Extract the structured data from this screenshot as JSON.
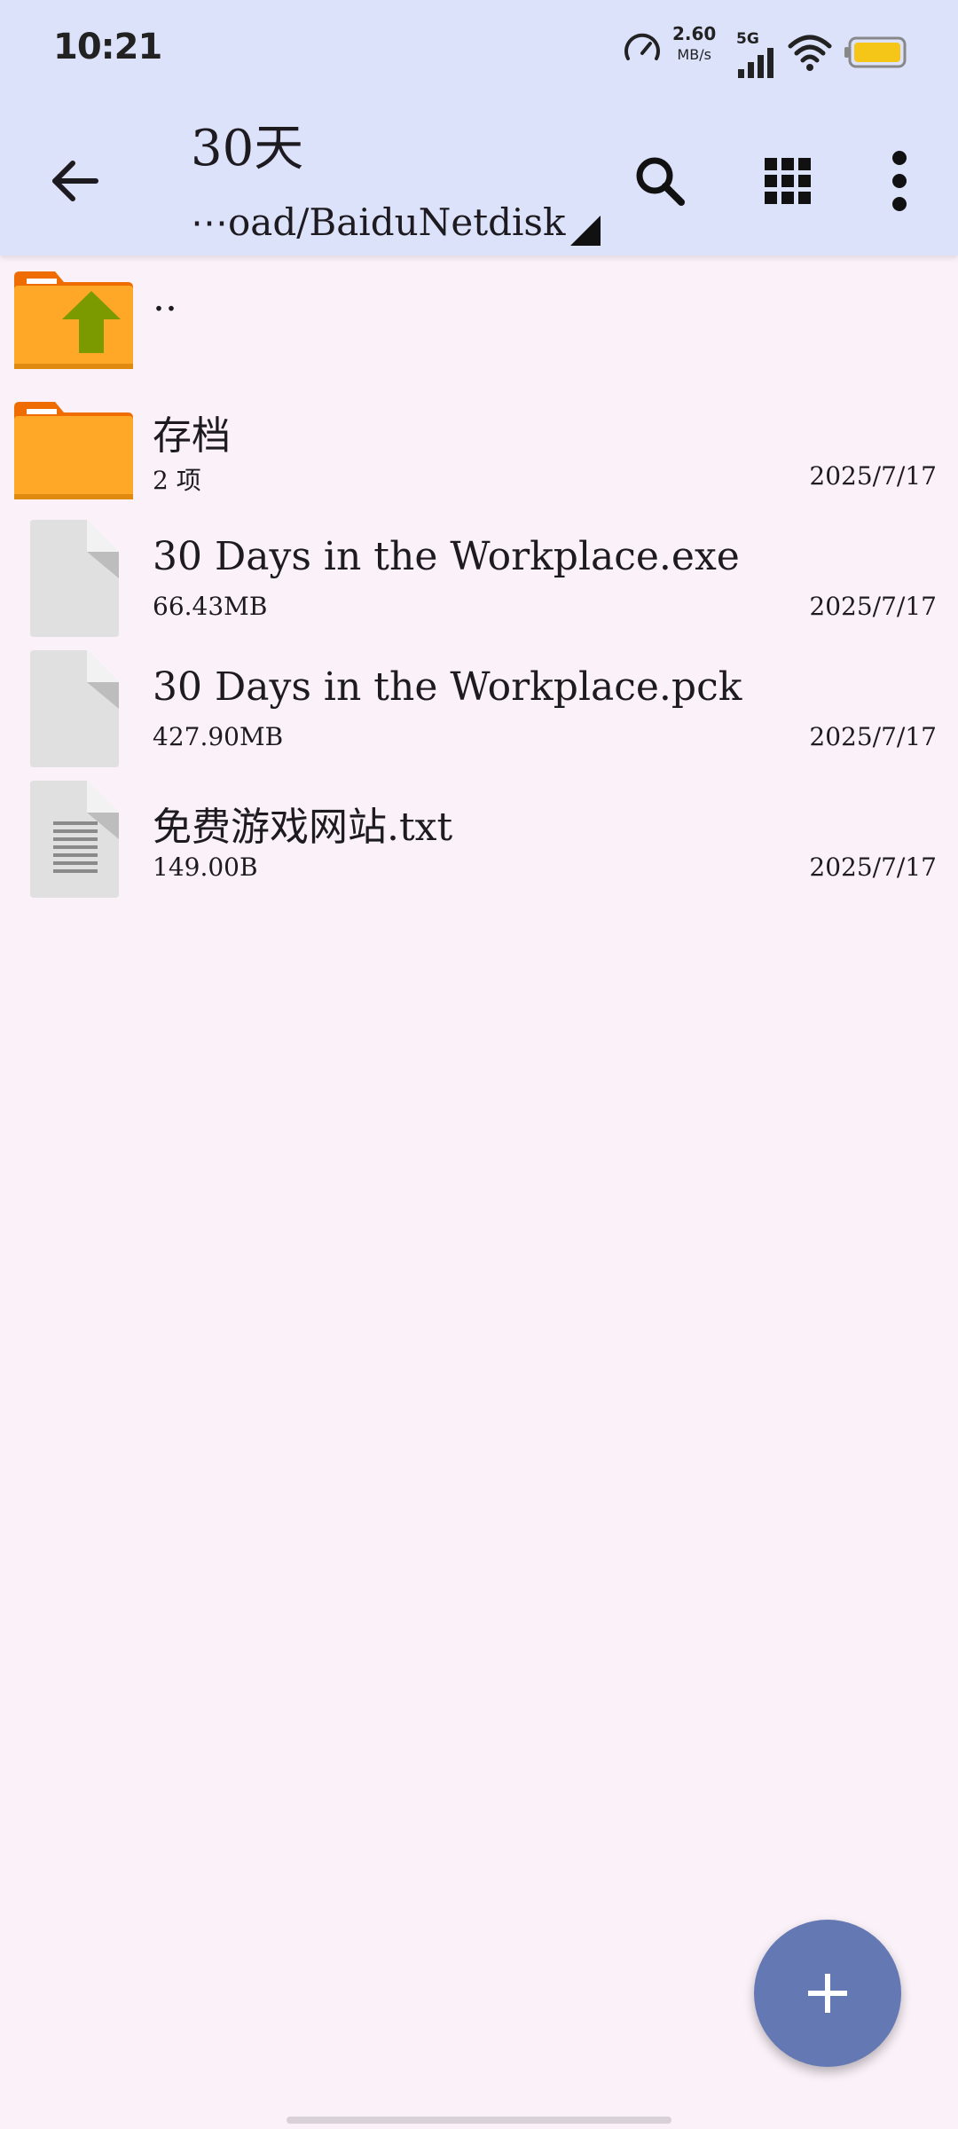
{
  "status_bar": {
    "time": "10:21",
    "net_speed_value": "2.60",
    "net_speed_unit": "MB/s",
    "network_type": "5G",
    "battery_color": "#f5c518"
  },
  "app_bar": {
    "title": "30天",
    "path": "⋯oad/BaiduNetdisk",
    "background": "#dde2fb"
  },
  "files": [
    {
      "name": "..",
      "kind": "parent-folder",
      "meta": "",
      "date": ""
    },
    {
      "name": "存档",
      "kind": "folder",
      "meta": "2 项",
      "date": "2025/7/17"
    },
    {
      "name": "30 Days in the Workplace.exe",
      "kind": "file",
      "meta": "66.43MB",
      "date": "2025/7/17"
    },
    {
      "name": "30 Days in the Workplace.pck",
      "kind": "file",
      "meta": "427.90MB",
      "date": "2025/7/17"
    },
    {
      "name": "免费游戏网站.txt",
      "kind": "text-file",
      "meta": "149.00B",
      "date": "2025/7/17"
    }
  ],
  "fab": {
    "color": "#6478b4",
    "icon": "plus-icon"
  },
  "colors": {
    "page_background": "#fbf2f9",
    "folder_orange": "#ffa726",
    "folder_tab": "#ef6c00",
    "up_arrow_green": "#7a9a00",
    "file_gray": "#e0e0e0"
  }
}
